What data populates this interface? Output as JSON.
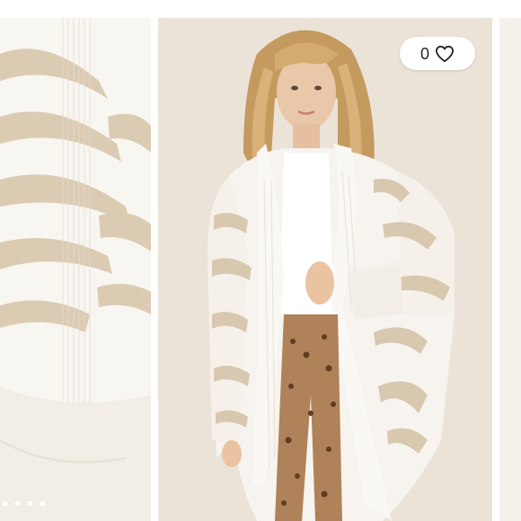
{
  "carousel": {
    "like_count": "0",
    "like_icon": "heart-outline-icon",
    "dot_count": 4
  },
  "colors": {
    "background": "#ffffff",
    "sweater_cream": "#f7f4ef",
    "sweater_stripe": "#d9c8b0",
    "backdrop": "#ebe3d8",
    "leggings": "#b0825a",
    "pill": "#ffffff"
  }
}
